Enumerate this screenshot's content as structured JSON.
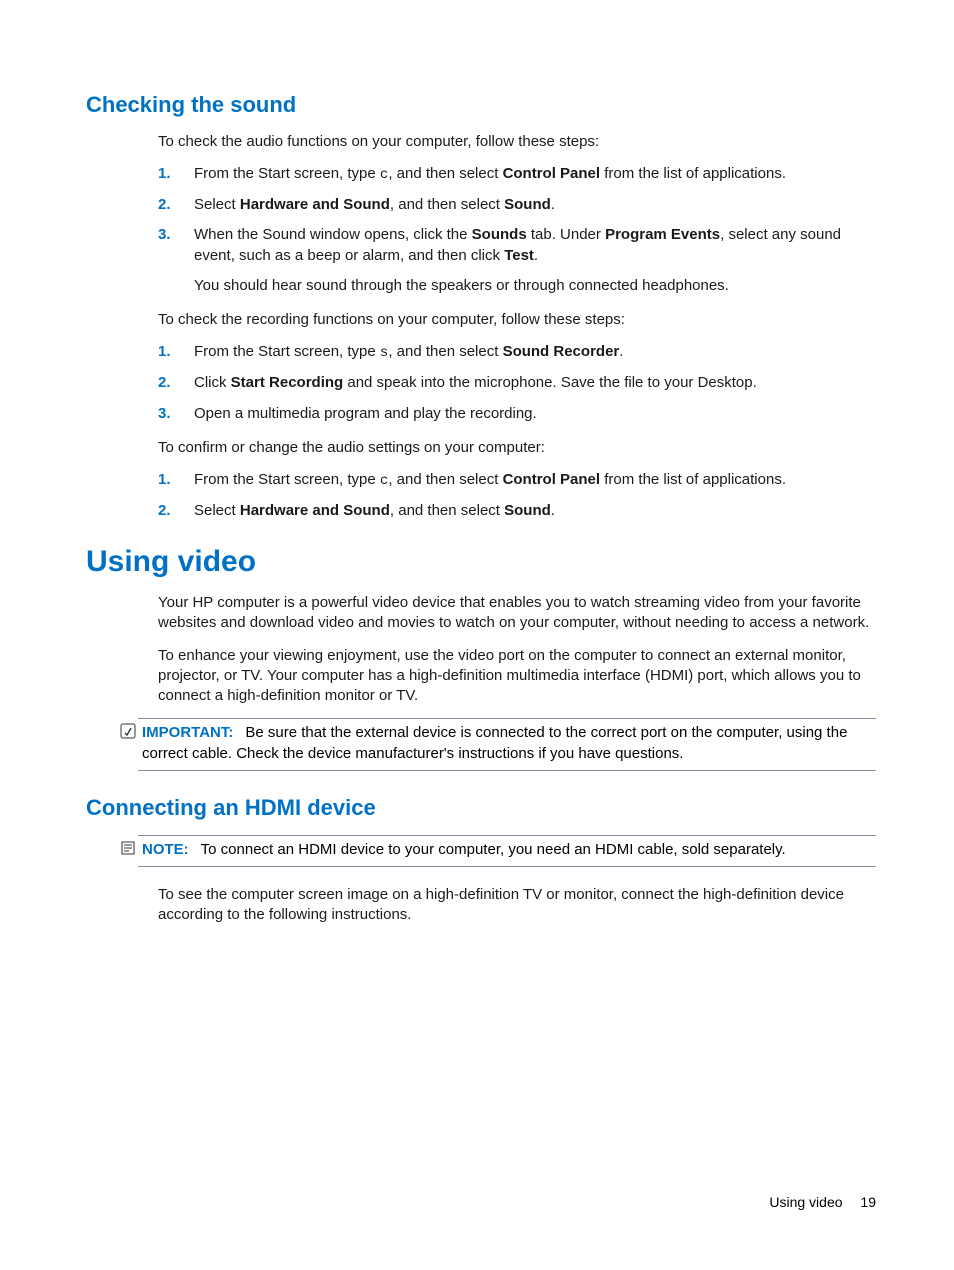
{
  "section1": {
    "heading": "Checking the sound",
    "intro": "To check the audio functions on your computer, follow these steps:",
    "list1": {
      "i1a": "From the Start screen, type ",
      "i1key": "c",
      "i1b": ", and then select ",
      "i1bold": "Control Panel",
      "i1c": " from the list of applications.",
      "i2a": "Select ",
      "i2bold1": "Hardware and Sound",
      "i2b": ", and then select ",
      "i2bold2": "Sound",
      "i2c": ".",
      "i3a": "When the Sound window opens, click the ",
      "i3bold1": "Sounds",
      "i3b": " tab. Under ",
      "i3bold2": "Program Events",
      "i3c": ", select any sound event, such as a beep or alarm, and then click ",
      "i3bold3": "Test",
      "i3d": ".",
      "i3sub": "You should hear sound through the speakers or through connected headphones."
    },
    "intro2": "To check the recording functions on your computer, follow these steps:",
    "list2": {
      "i1a": "From the Start screen, type ",
      "i1key": "s",
      "i1b": ", and then select ",
      "i1bold": "Sound Recorder",
      "i1c": ".",
      "i2a": "Click ",
      "i2bold": "Start Recording",
      "i2b": " and speak into the microphone. Save the file to your Desktop.",
      "i3": "Open a multimedia program and play the recording."
    },
    "intro3": "To confirm or change the audio settings on your computer:",
    "list3": {
      "i1a": "From the Start screen, type ",
      "i1key": "c",
      "i1b": ", and then select ",
      "i1bold": "Control Panel",
      "i1c": " from the list of applications.",
      "i2a": "Select ",
      "i2bold1": "Hardware and Sound",
      "i2b": ", and then select ",
      "i2bold2": "Sound",
      "i2c": "."
    }
  },
  "section2": {
    "heading": "Using video",
    "p1": "Your HP computer is a powerful video device that enables you to watch streaming video from your favorite websites and download video and movies to watch on your computer, without needing to access a network.",
    "p2": "To enhance your viewing enjoyment, use the video port on the computer to connect an external monitor, projector, or TV. Your computer has a high-definition multimedia interface (HDMI) port, which allows you to connect a high-definition monitor or TV.",
    "important": {
      "label": "IMPORTANT:",
      "text": "Be sure that the external device is connected to the correct port on the computer, using the correct cable. Check the device manufacturer's instructions if you have questions."
    }
  },
  "section3": {
    "heading": "Connecting an HDMI device",
    "note": {
      "label": "NOTE:",
      "text": "To connect an HDMI device to your computer, you need an HDMI cable, sold separately."
    },
    "p1": "To see the computer screen image on a high-definition TV or monitor, connect the high-definition device according to the following instructions."
  },
  "footer": {
    "text": "Using video",
    "page": "19"
  }
}
